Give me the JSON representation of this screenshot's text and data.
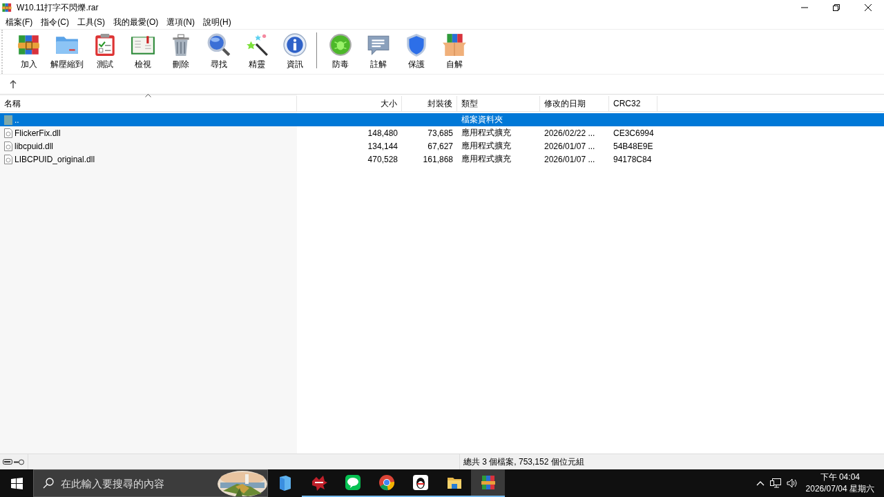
{
  "window": {
    "title": "W10.11打字不閃爍.rar"
  },
  "menu": [
    "檔案(F)",
    "指令(C)",
    "工具(S)",
    "我的最愛(O)",
    "選項(N)",
    "說明(H)"
  ],
  "toolbar": {
    "groups": [
      [
        "加入",
        "解壓縮到",
        "測試",
        "檢視",
        "刪除",
        "尋找",
        "精靈",
        "資訊"
      ],
      [
        "防毒",
        "註解",
        "保護",
        "自解"
      ]
    ]
  },
  "table": {
    "columns": [
      {
        "label": "名稱",
        "sorted": true
      },
      {
        "label": "大小",
        "sorted": false
      },
      {
        "label": "封裝後",
        "sorted": false
      },
      {
        "label": "類型",
        "sorted": false
      },
      {
        "label": "修改的日期",
        "sorted": false
      },
      {
        "label": "CRC32",
        "sorted": false
      }
    ],
    "rows": [
      {
        "kind": "parent",
        "selected": true,
        "cells": [
          "..",
          "",
          "",
          "檔案資料夾",
          "",
          ""
        ]
      },
      {
        "kind": "file",
        "selected": false,
        "cells": [
          "FlickerFix.dll",
          "148,480",
          "73,685",
          "應用程式擴充",
          "2026/02/22 ...",
          "CE3C6994"
        ]
      },
      {
        "kind": "file",
        "selected": false,
        "cells": [
          "libcpuid.dll",
          "134,144",
          "67,627",
          "應用程式擴充",
          "2026/01/07 ...",
          "54B48E9E"
        ]
      },
      {
        "kind": "file",
        "selected": false,
        "cells": [
          "LIBCPUID_original.dll",
          "470,528",
          "161,868",
          "應用程式擴充",
          "2026/01/07 ...",
          "94178C84"
        ]
      }
    ]
  },
  "status_bar": {
    "summary": "總共 3 個檔案, 753,152 個位元組"
  },
  "taskbar": {
    "search": {
      "placeholder": "在此輸入要搜尋的內容"
    },
    "apps": [
      {
        "running": false,
        "selected": false
      },
      {
        "running": true,
        "selected": false
      },
      {
        "running": true,
        "selected": false
      },
      {
        "running": true,
        "selected": false
      },
      {
        "running": true,
        "selected": false
      },
      {
        "running": true,
        "selected": false
      },
      {
        "running": true,
        "selected": true
      }
    ],
    "clock": {
      "time": "下午 04:04",
      "date": "2026/07/04 星期六"
    }
  }
}
